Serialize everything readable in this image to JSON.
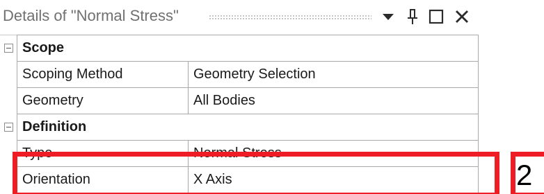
{
  "panel": {
    "title": "Details of \"Normal Stress\"",
    "icons": {
      "dropdown": "chevron-down-icon",
      "pin": "pin-icon",
      "maximize": "maximize-icon",
      "close": "close-icon"
    }
  },
  "groups": [
    {
      "label": "Scope",
      "rows": [
        {
          "name": "Scoping Method",
          "value": "Geometry Selection"
        },
        {
          "name": "Geometry",
          "value": "All Bodies"
        }
      ]
    },
    {
      "label": "Definition",
      "rows": [
        {
          "name": "Type",
          "value": "Normal Stress"
        },
        {
          "name": "Orientation",
          "value": "X Axis"
        }
      ]
    }
  ],
  "annotation": {
    "step_number": "2",
    "highlight_color": "#ee1c25"
  }
}
